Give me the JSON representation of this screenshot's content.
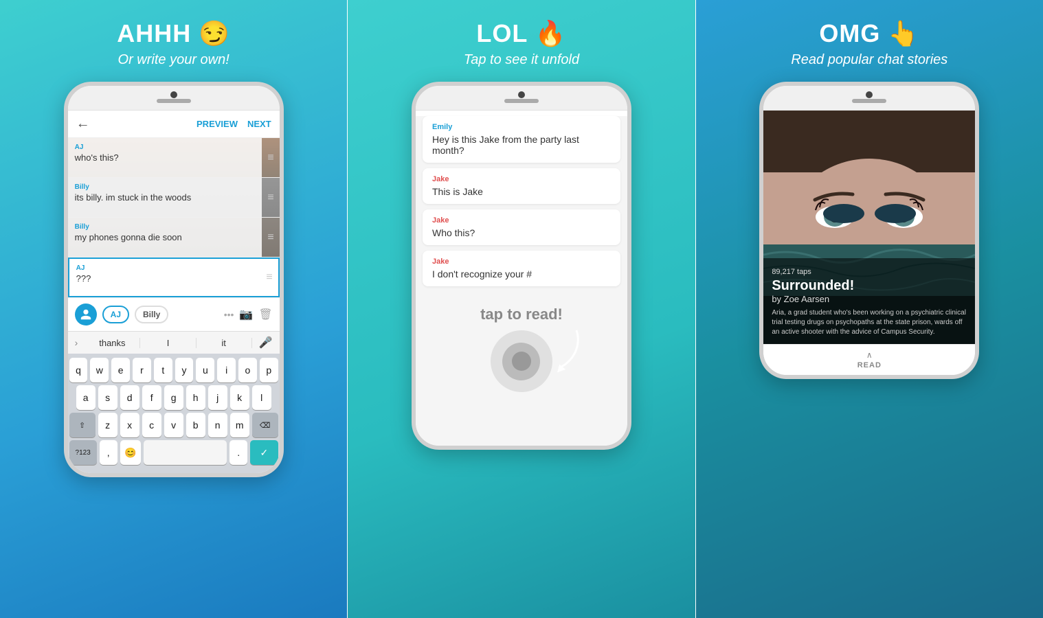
{
  "panels": [
    {
      "id": "panel-1",
      "title": "AHHH 😏",
      "subtitle": "Or write your own!",
      "nav": {
        "back": "←",
        "preview": "PREVIEW",
        "next": "NEXT"
      },
      "messages": [
        {
          "sender": "AJ",
          "text": "who's this?",
          "hasImage": true
        },
        {
          "sender": "Billy",
          "text": "its billy. im stuck in the woods",
          "hasImage": true
        },
        {
          "sender": "Billy",
          "text": "my phones gonna die soon",
          "hasImage": true
        },
        {
          "sender": "AJ",
          "text": "???",
          "hasImage": false,
          "active": true
        }
      ],
      "characters": [
        "AJ",
        "Billy"
      ],
      "autocomplete": [
        "thanks",
        "I",
        "it"
      ],
      "keyboard_rows": [
        [
          "q",
          "w",
          "e",
          "r",
          "t",
          "y",
          "u",
          "i",
          "o",
          "p"
        ],
        [
          "a",
          "s",
          "d",
          "f",
          "g",
          "h",
          "j",
          "k",
          "l"
        ],
        [
          "z",
          "x",
          "c",
          "v",
          "b",
          "n",
          "m"
        ]
      ],
      "bottom_keys": [
        "?123",
        ",",
        "😊",
        ".",
        "✓"
      ]
    },
    {
      "id": "panel-2",
      "title": "LOL 🔥",
      "subtitle": "Tap to see it unfold",
      "messages": [
        {
          "sender": "Emily",
          "senderColor": "blue",
          "text": "Hey is this Jake from the party last month?"
        },
        {
          "sender": "Jake",
          "senderColor": "red",
          "text": "This is Jake"
        },
        {
          "sender": "Jake",
          "senderColor": "red",
          "text": "Who this?"
        },
        {
          "sender": "Jake",
          "senderColor": "red",
          "text": "I don't recognize your #"
        }
      ],
      "tap_label": "tap to read!"
    },
    {
      "id": "panel-3",
      "title": "OMG 👆",
      "subtitle": "Read popular chat stories",
      "story": {
        "taps": "89,217 taps",
        "title": "Surrounded!",
        "author": "by Zoe Aarsen",
        "description": "Aria, a grad student who's been working on a psychiatric clinical trial testing drugs on psychopaths at the state prison, wards off an active shooter with the advice of Campus Security."
      },
      "read_label": "READ"
    }
  ]
}
